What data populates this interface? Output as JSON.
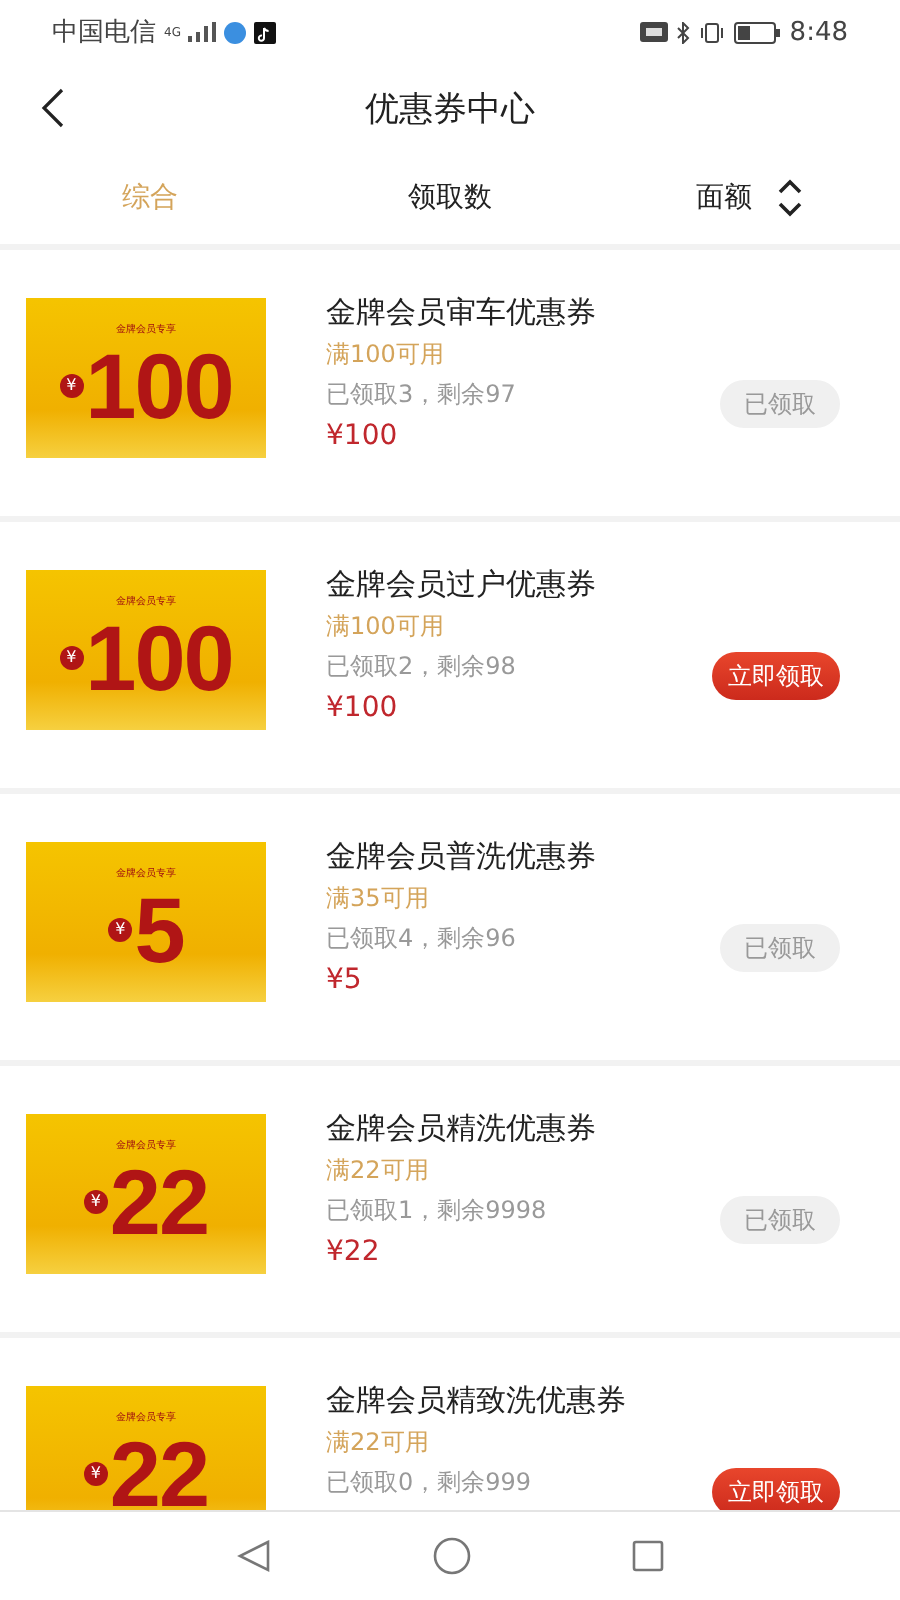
{
  "status_bar": {
    "carrier": "中国电信",
    "network": "4G",
    "time": "8:48"
  },
  "header": {
    "title": "优惠券中心"
  },
  "tabs": [
    {
      "label": "综合",
      "selected": true,
      "sortable": false
    },
    {
      "label": "领取数",
      "selected": false,
      "sortable": false
    },
    {
      "label": "面额",
      "selected": false,
      "sortable": true
    }
  ],
  "coupons": [
    {
      "badge": "金牌会员专享",
      "currency": "¥",
      "value": "100",
      "title": "金牌会员审车优惠券",
      "condition": "满100可用",
      "stats": "已领取3，剩余97",
      "price": "¥100",
      "button": "已领取",
      "claimed": true
    },
    {
      "badge": "金牌会员专享",
      "currency": "¥",
      "value": "100",
      "title": "金牌会员过户优惠券",
      "condition": "满100可用",
      "stats": "已领取2，剩余98",
      "price": "¥100",
      "button": "立即领取",
      "claimed": false
    },
    {
      "badge": "金牌会员专享",
      "currency": "¥",
      "value": "5",
      "title": "金牌会员普洗优惠券",
      "condition": "满35可用",
      "stats": "已领取4，剩余96",
      "price": "¥5",
      "button": "已领取",
      "claimed": true
    },
    {
      "badge": "金牌会员专享",
      "currency": "¥",
      "value": "22",
      "title": "金牌会员精洗优惠券",
      "condition": "满22可用",
      "stats": "已领取1，剩余9998",
      "price": "¥22",
      "button": "已领取",
      "claimed": true
    },
    {
      "badge": "金牌会员专享",
      "currency": "¥",
      "value": "22",
      "title": "金牌会员精致洗优惠券",
      "condition": "满22可用",
      "stats": "已领取0，剩余999",
      "button": "立即领取",
      "claimed": false
    }
  ]
}
